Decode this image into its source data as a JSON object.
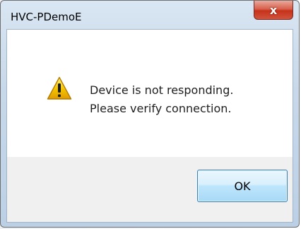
{
  "window": {
    "title": "HVC-PDemoE",
    "close_glyph": "x"
  },
  "dialog": {
    "icon": "warning-icon",
    "message_line1": "Device is not responding.",
    "message_line2": "Please verify connection.",
    "ok_label": "OK"
  },
  "colors": {
    "close_button": "#c7321a",
    "ok_button_border": "#3c7fb1",
    "warning_yellow": "#f5c400"
  }
}
